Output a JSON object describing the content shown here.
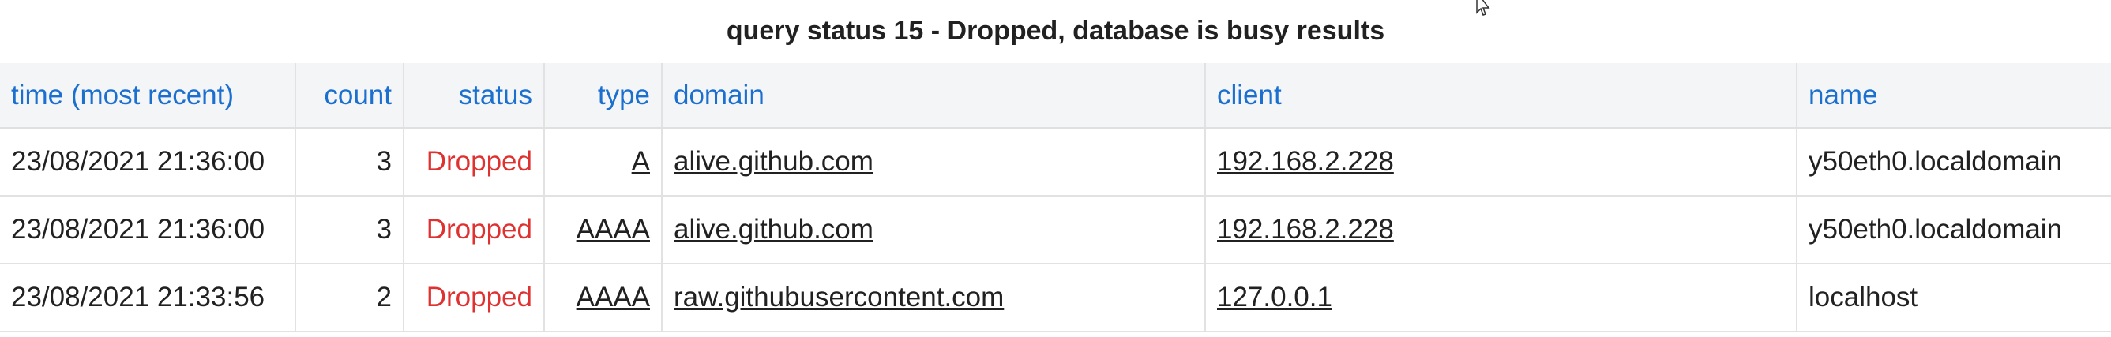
{
  "report": {
    "title": "query status 15 - Dropped, database is busy results"
  },
  "table": {
    "columns": {
      "time": "time (most recent)",
      "count": "count",
      "status": "status",
      "type": "type",
      "domain": "domain",
      "client": "client",
      "name": "name"
    },
    "rows": [
      {
        "time": "23/08/2021 21:36:00",
        "count": "3",
        "status": "Dropped",
        "type": "A",
        "domain": "alive.github.com",
        "client": "192.168.2.228",
        "name": "y50eth0.localdomain"
      },
      {
        "time": "23/08/2021 21:36:00",
        "count": "3",
        "status": "Dropped",
        "type": "AAAA",
        "domain": "alive.github.com",
        "client": "192.168.2.228",
        "name": "y50eth0.localdomain"
      },
      {
        "time": "23/08/2021 21:33:56",
        "count": "2",
        "status": "Dropped",
        "type": "AAAA",
        "domain": "raw.githubusercontent.com",
        "client": "127.0.0.1",
        "name": "localhost"
      }
    ]
  },
  "colors": {
    "header_text": "#1a6fcf",
    "status_dropped": "#e03131",
    "header_background": "#f4f5f6"
  },
  "icons": {
    "cursor": "mouse-pointer-icon"
  }
}
